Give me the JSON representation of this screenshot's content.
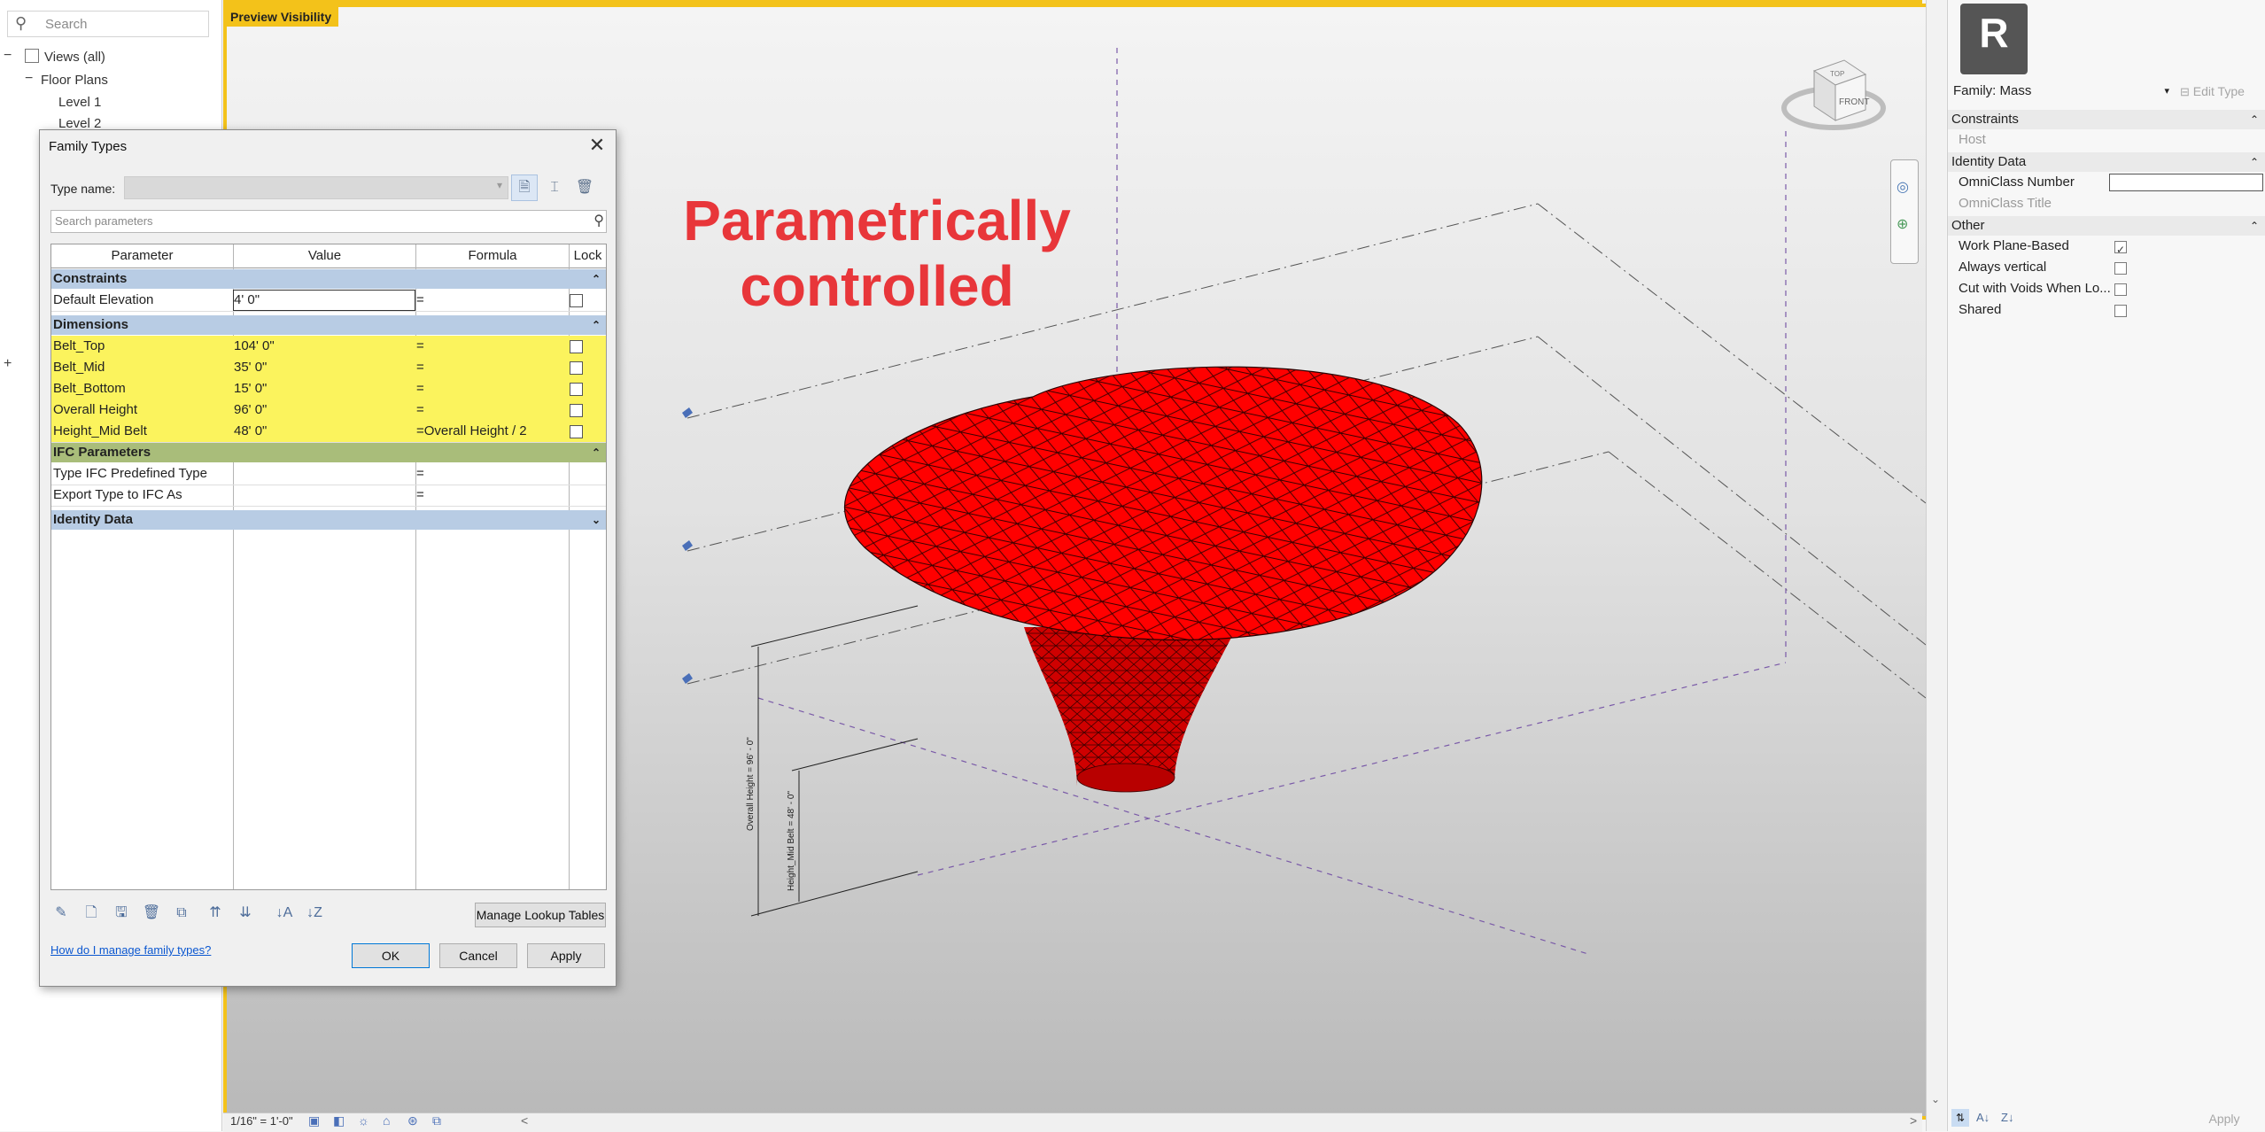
{
  "browser": {
    "search_placeholder": "Search",
    "tree": [
      {
        "label": "Views (all)",
        "toggle": "−"
      },
      {
        "label": "Floor Plans",
        "toggle": "−"
      },
      {
        "label": "Level 1"
      },
      {
        "label": "Level 2"
      }
    ]
  },
  "viewport": {
    "preview_label": "Preview Visibility",
    "title_line1": "Parametrically",
    "title_line2": "controlled",
    "dim_overall": "Overall Height = 96' - 0\"",
    "dim_mid": "Height_Mid Belt = 48' - 0\"",
    "mass_color": "#ff0000",
    "cube_top": "TOP",
    "cube_front": "FRONT",
    "scale": "1/16\" = 1'-0\""
  },
  "dialog": {
    "title": "Family Types",
    "type_name_label": "Type name:",
    "search_placeholder": "Search parameters",
    "columns": [
      "Parameter",
      "Value",
      "Formula",
      "Lock"
    ],
    "groups": {
      "constraints": "Constraints",
      "dimensions": "Dimensions",
      "ifc": "IFC Parameters",
      "identity": "Identity Data"
    },
    "constraints_rows": [
      {
        "param": "Default Elevation",
        "value": "4'  0\"",
        "formula": "="
      }
    ],
    "dimension_rows": [
      {
        "param": "Belt_Top",
        "value": "104'  0\"",
        "formula": "="
      },
      {
        "param": "Belt_Mid",
        "value": "35'  0\"",
        "formula": "="
      },
      {
        "param": "Belt_Bottom",
        "value": "15'  0\"",
        "formula": "="
      },
      {
        "param": "Overall Height",
        "value": "96'  0\"",
        "formula": "="
      },
      {
        "param": "Height_Mid Belt",
        "value": "48'  0\"",
        "formula": "=Overall Height / 2"
      }
    ],
    "ifc_rows": [
      {
        "param": "Type IFC Predefined Type",
        "value": "",
        "formula": "="
      },
      {
        "param": "Export Type to IFC As",
        "value": "",
        "formula": "="
      }
    ],
    "manage_lookup": "Manage Lookup Tables",
    "help_link": "How do I manage family types?",
    "ok": "OK",
    "cancel": "Cancel",
    "apply": "Apply",
    "highlight_color": "#fbf35d",
    "group_color": "#b8cce4"
  },
  "properties": {
    "family": "Family: Mass",
    "edit_type": "Edit Type",
    "groups": {
      "constraints": "Constraints",
      "identity": "Identity Data",
      "other": "Other"
    },
    "host": "Host",
    "omniclass_number": "OmniClass Number",
    "omniclass_title": "OmniClass Title",
    "other_rows": [
      {
        "label": "Work Plane-Based",
        "checked": true
      },
      {
        "label": "Always vertical",
        "checked": false
      },
      {
        "label": "Cut with Voids When Lo...",
        "checked": false
      },
      {
        "label": "Shared",
        "checked": false
      }
    ],
    "apply": "Apply"
  }
}
